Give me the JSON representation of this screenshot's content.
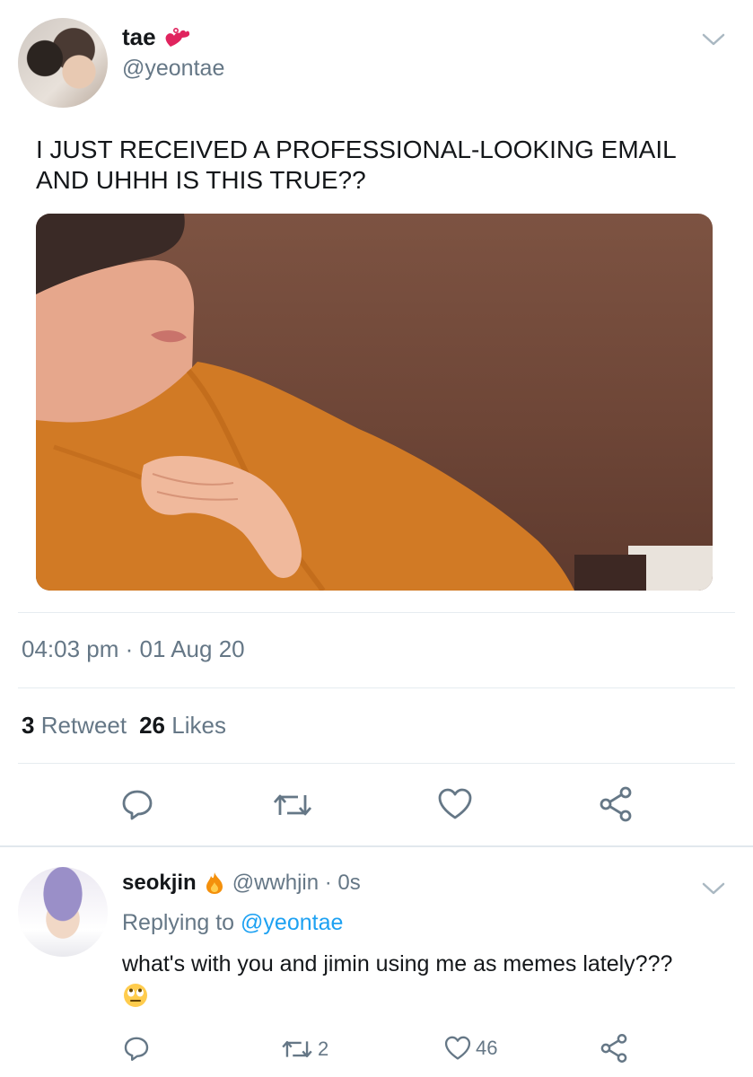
{
  "tweet": {
    "display_name": "tae",
    "handle": "@yeontae",
    "text": "I JUST RECEIVED A PROFESSIONAL-LOOKING EMAIL AND UHHH IS THIS TRUE??",
    "timestamp": "04:03 pm · 01 Aug 20",
    "retweet_count": "3",
    "retweet_label": "Retweet",
    "like_count": "26",
    "like_label": "Likes",
    "icons": {
      "name_emoji": "revolving-hearts-icon",
      "menu": "chevron-down-icon",
      "reply": "reply-icon",
      "retweet": "retweet-icon",
      "like": "heart-icon",
      "share": "share-icon"
    }
  },
  "reply": {
    "display_name": "seokjin",
    "handle_time": "@wwhjin · 0s",
    "replying_prefix": "Replying to",
    "replying_to": "@yeontae",
    "text": "what's with you and jimin using me as memes lately???",
    "retweet_count": "2",
    "like_count": "46",
    "icons": {
      "name_emoji": "fire-icon",
      "text_emoji": "face-rolling-eyes-icon",
      "menu": "chevron-down-icon"
    }
  },
  "colors": {
    "text_primary": "#14171a",
    "text_secondary": "#657786",
    "link": "#1da1f2",
    "divider": "#e6ecf0"
  }
}
